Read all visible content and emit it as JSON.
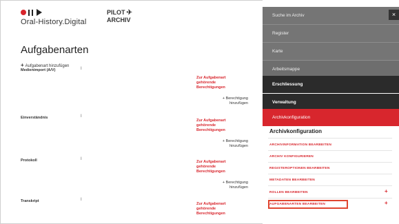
{
  "brand": {
    "logo_text": "Oral-History.Digital",
    "pilot_text": "PILOT",
    "archiv_text": "ARCHIV",
    "plane_glyph": "✈"
  },
  "page": {
    "title": "Aufgabenarten",
    "add_label": "Aufgabenart hinzufügen"
  },
  "rows": [
    {
      "label": "Medienimport (A/V)",
      "mark": "I"
    },
    {
      "label": "Einverständnis",
      "mark": "I"
    },
    {
      "label": "Protokoll",
      "mark": "I"
    },
    {
      "label": "Transkript",
      "mark": "I"
    }
  ],
  "permissions": {
    "link_line1": "Zur Aufgabenart",
    "link_line2": "gehörende",
    "link_line3": "Berechtigungen",
    "add_line1": "Berechtigung",
    "add_line2": "hinzufügen"
  },
  "sidebar": {
    "close": "×",
    "menu": [
      "Suche im Archiv",
      "Register",
      "Karte",
      "Arbeitsmappe",
      "Erschliessung",
      "Verwaltung",
      "Archivkonfiguration"
    ],
    "submenu_title": "Archivkonfiguration",
    "submenu": [
      "ARCHIVINFORMATION BEARBEITEN",
      "ARCHIV KONFIGURIEREN",
      "REGISTEROPTIONEN BEARBEITEN",
      "METADATEN BEARBEITEN",
      "ROLLEN BEARBEITEN",
      "AUFGABENARTEN BEARBEITEN"
    ]
  },
  "colors": {
    "accent": "#d8262d",
    "menu_gray": "#757575",
    "menu_dark": "#2b2b2b"
  }
}
